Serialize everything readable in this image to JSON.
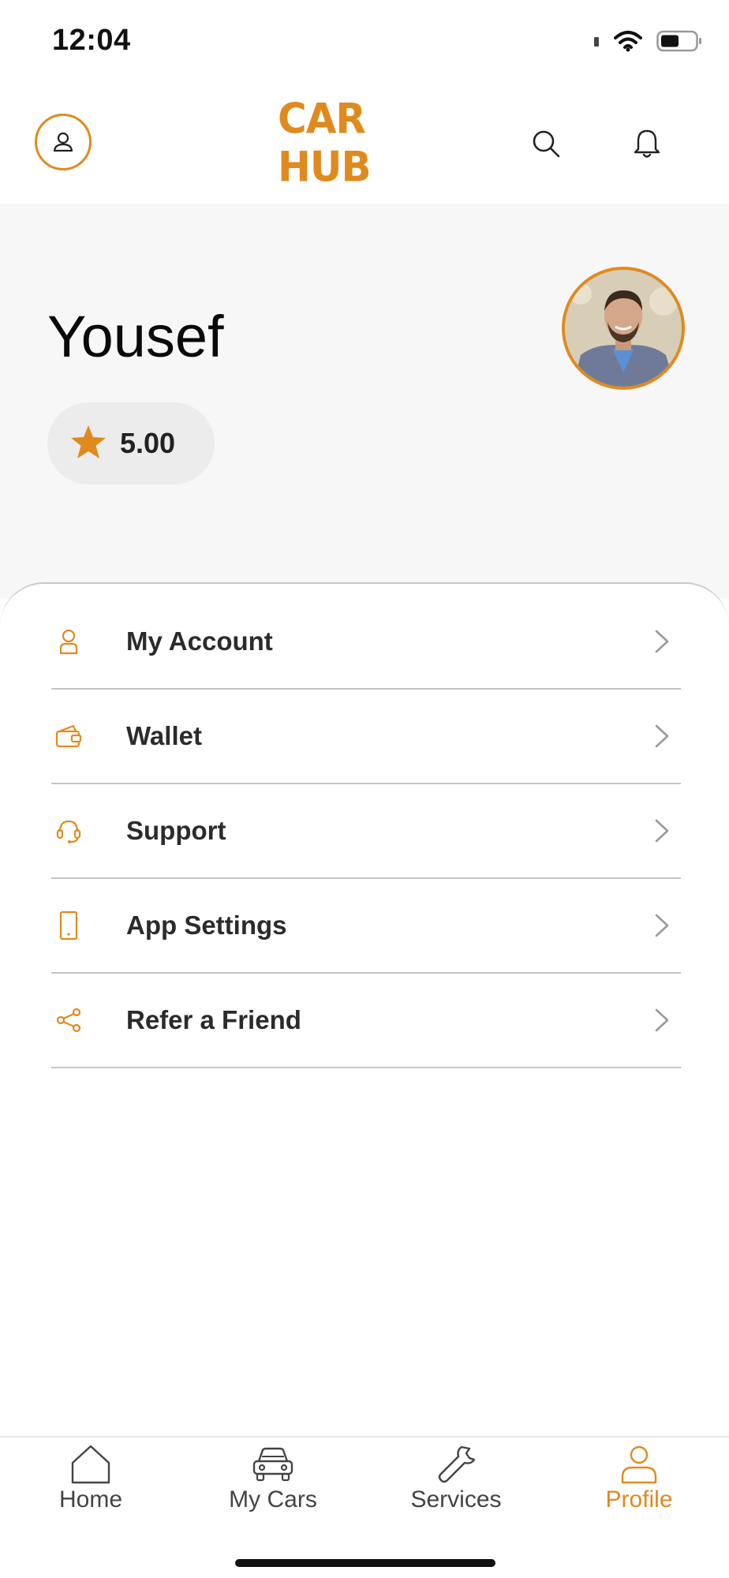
{
  "status_bar": {
    "time": "12:04"
  },
  "header": {
    "brand": "CAR HUB",
    "icons": {
      "left": "user-circle-icon",
      "search": "search-icon",
      "notifications": "bell-icon"
    }
  },
  "profile": {
    "name": "Yousef",
    "rating": "5.00",
    "rating_icon": "star-icon"
  },
  "menu": {
    "items": [
      {
        "label": "My Account",
        "icon": "user-icon"
      },
      {
        "label": "Wallet",
        "icon": "wallet-icon"
      },
      {
        "label": "Support",
        "icon": "headset-icon"
      },
      {
        "label": "App Settings",
        "icon": "phone-icon"
      },
      {
        "label": "Refer a Friend",
        "icon": "share-icon"
      }
    ]
  },
  "bottom_nav": {
    "items": [
      {
        "label": "Home",
        "icon": "home-icon",
        "active": false
      },
      {
        "label": "My Cars",
        "icon": "car-icon",
        "active": false
      },
      {
        "label": "Services",
        "icon": "wrench-icon",
        "active": false
      },
      {
        "label": "Profile",
        "icon": "profile-icon",
        "active": true
      }
    ]
  },
  "colors": {
    "accent": "#e08a1e",
    "text": "#2b2b2b",
    "hero_bg": "#f7f7f7",
    "divider": "#c4c4c4"
  }
}
